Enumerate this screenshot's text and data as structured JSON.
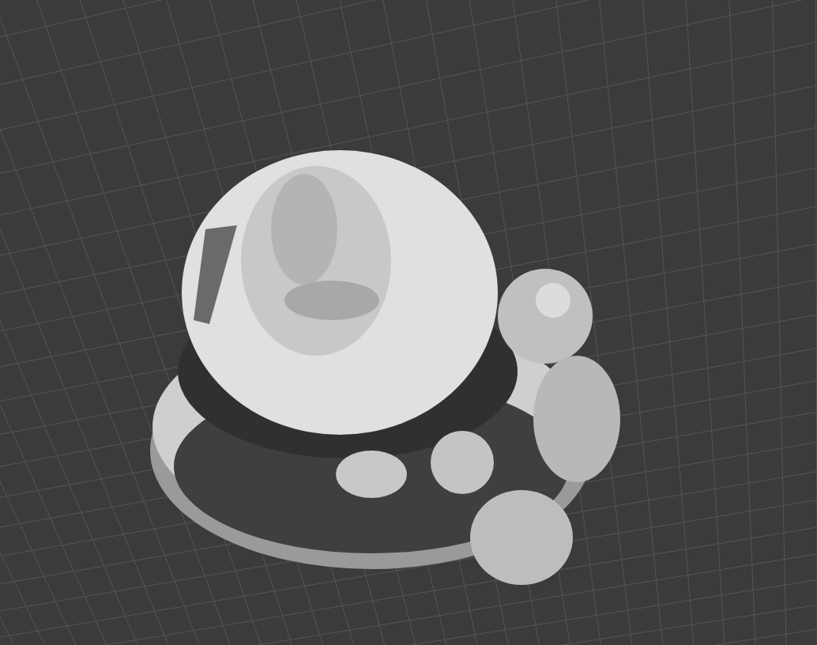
{
  "viewport": {
    "grid": {
      "visible": true
    },
    "model": {
      "visible": true
    }
  }
}
